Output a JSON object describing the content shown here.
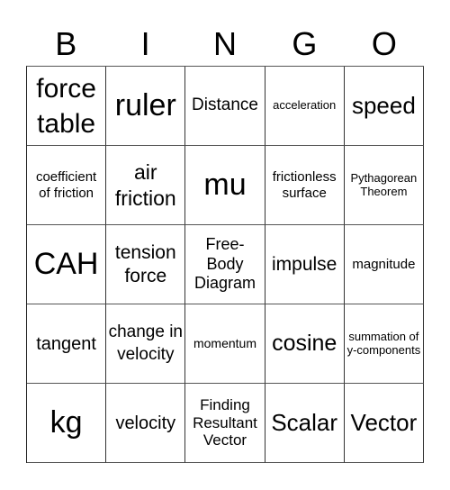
{
  "header": {
    "letters": [
      "B",
      "I",
      "N",
      "G",
      "O"
    ]
  },
  "card": {
    "rows": [
      [
        "force table",
        "ruler",
        "Distance",
        "acceleration",
        "speed"
      ],
      [
        "coefficient of friction",
        "air friction",
        "mu",
        "frictionless surface",
        "Pythagorean Theorem"
      ],
      [
        "CAH",
        "tension force",
        "Free-Body Diagram",
        "impulse",
        "magnitude"
      ],
      [
        "tangent",
        "change in velocity",
        "momentum",
        "cosine",
        "summation of y-components"
      ],
      [
        "kg",
        "velocity",
        "Finding Resultant Vector",
        "Scalar",
        "Vector"
      ]
    ]
  }
}
